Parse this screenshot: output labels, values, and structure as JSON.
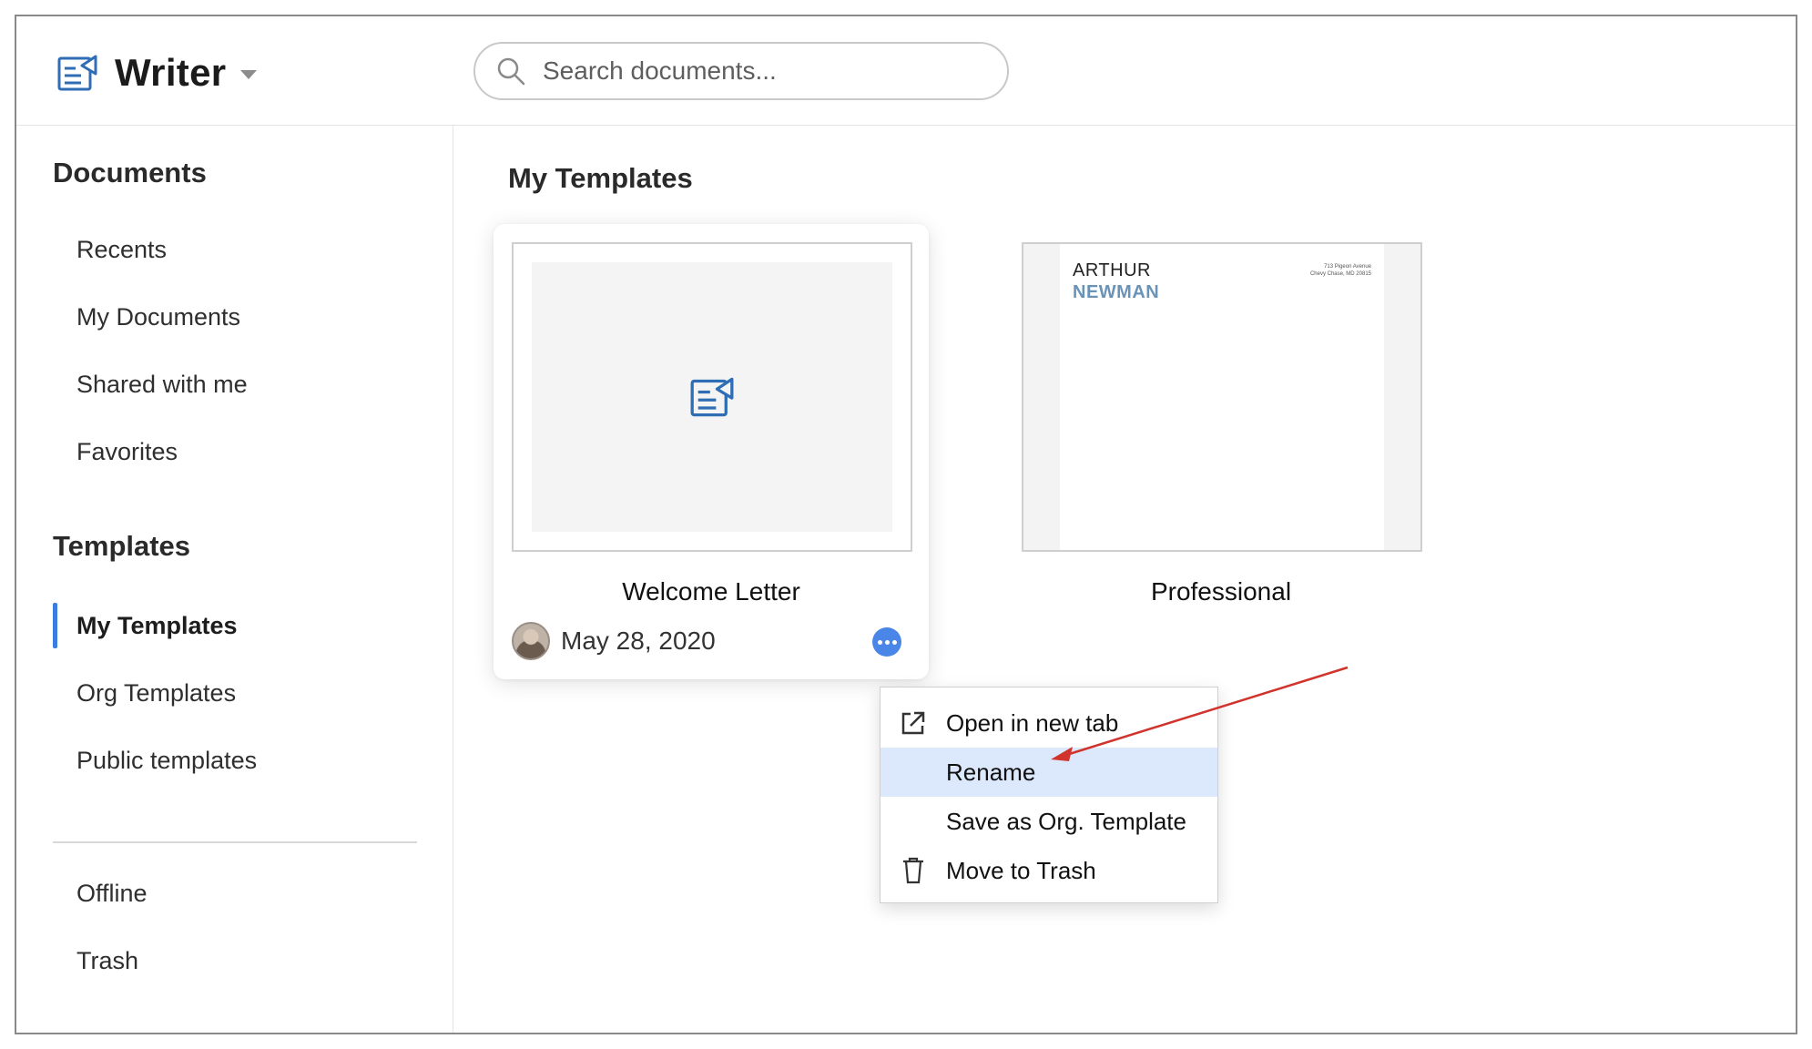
{
  "app": {
    "name": "Writer"
  },
  "search": {
    "placeholder": "Search documents..."
  },
  "sidebar": {
    "documents_title": "Documents",
    "documents_items": [
      "Recents",
      "My Documents",
      "Shared with me",
      "Favorites"
    ],
    "templates_title": "Templates",
    "templates_items": [
      "My Templates",
      "Org Templates",
      "Public templates"
    ],
    "active_item": "My Templates",
    "extra_items": [
      "Offline",
      "Trash"
    ]
  },
  "main": {
    "title": "My Templates",
    "templates": [
      {
        "title": "Welcome Letter",
        "date": "May 28, 2020"
      },
      {
        "title": "Professional",
        "preview_first": "ARTHUR",
        "preview_last": "NEWMAN",
        "preview_addr1": "713 Pigeon Avenue",
        "preview_addr2": "Chevy Chase, MD 20815"
      }
    ]
  },
  "context_menu": {
    "items": [
      "Open in new tab",
      "Rename",
      "Save as Org. Template",
      "Move to Trash"
    ],
    "highlighted": "Rename"
  },
  "colors": {
    "accent": "#3b7ddd",
    "more_button": "#4a86e8",
    "menu_highlight": "#dce8fb",
    "annotation_arrow": "#d0342c",
    "preview_name": "#6a93b8"
  },
  "icons": {
    "brand": "writer-doc-icon",
    "search": "search-icon",
    "open_tab": "external-link-icon",
    "trash": "trash-icon"
  }
}
